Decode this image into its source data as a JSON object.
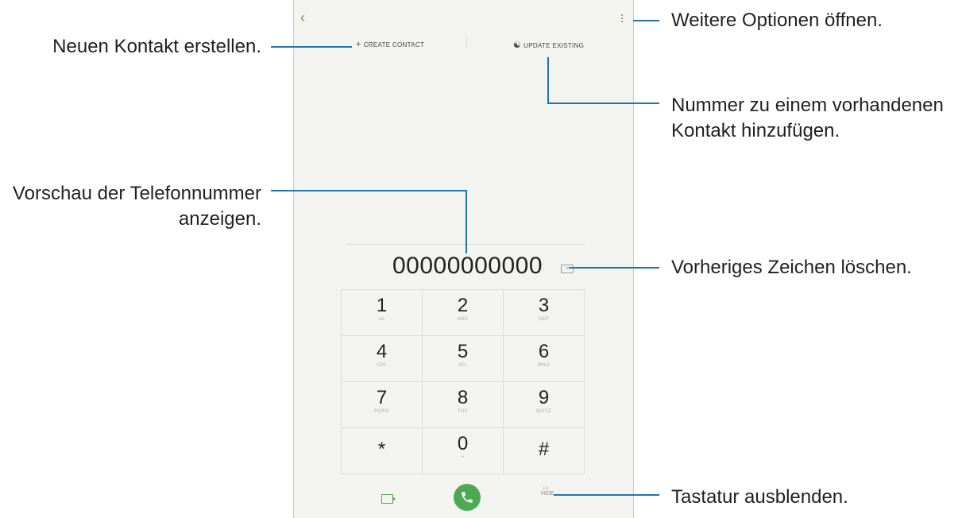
{
  "toolbar": {
    "back": "‹",
    "create_contact": "CREATE CONTACT",
    "update_existing": "UPDATE EXISTING"
  },
  "display": {
    "number": "00000000000"
  },
  "keypad": [
    {
      "digit": "1",
      "sub": "oo"
    },
    {
      "digit": "2",
      "sub": "ABC"
    },
    {
      "digit": "3",
      "sub": "DEF"
    },
    {
      "digit": "4",
      "sub": "GHI"
    },
    {
      "digit": "5",
      "sub": "JKL"
    },
    {
      "digit": "6",
      "sub": "MNO"
    },
    {
      "digit": "7",
      "sub": "PQRS"
    },
    {
      "digit": "8",
      "sub": "TUV"
    },
    {
      "digit": "9",
      "sub": "WXYZ"
    },
    {
      "digit": "*",
      "sub": ""
    },
    {
      "digit": "0",
      "sub": "+"
    },
    {
      "digit": "#",
      "sub": ""
    }
  ],
  "bottom": {
    "hide_label": "HIDE"
  },
  "annotations": {
    "create_contact": "Neuen Kontakt erstellen.",
    "more_options": "Weitere Optionen öffnen.",
    "add_existing_1": "Nummer zu einem vorhandenen",
    "add_existing_2": "Kontakt hinzufügen.",
    "preview_1": "Vorschau der Telefonnummer",
    "preview_2": "anzeigen.",
    "delete_char": "Vorheriges Zeichen löschen.",
    "hide_keypad": "Tastatur ausblenden."
  },
  "colors": {
    "leader": "#1d75b5",
    "accent": "#5aa05a",
    "call": "#4caa55"
  }
}
